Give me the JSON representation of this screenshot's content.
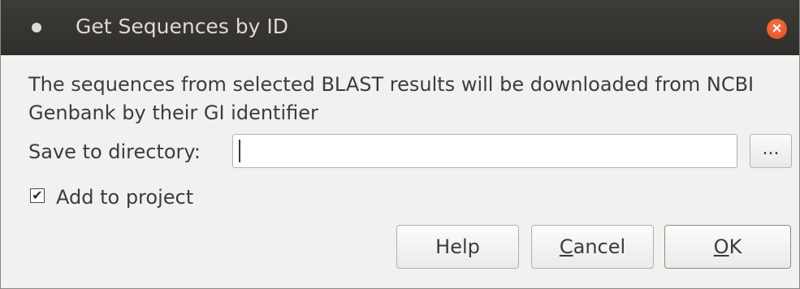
{
  "window": {
    "title": "Get Sequences by ID",
    "close_glyph": "×"
  },
  "message": "The sequences from selected BLAST results will be downloaded from NCBI Genbank by their GI identifier",
  "directory": {
    "label": "Save to directory:",
    "value": "",
    "browse_label": "..."
  },
  "add_to_project": {
    "label": "Add to project",
    "checked": true,
    "check_glyph": "✔"
  },
  "buttons": {
    "help": "Help",
    "cancel_mnemonic": "C",
    "cancel_rest": "ancel",
    "ok_mnemonic": "O",
    "ok_rest": "K"
  },
  "colors": {
    "titlebar": "#3a3935",
    "close_button": "#e9542a",
    "dialog_bg": "#f2f1f0"
  }
}
